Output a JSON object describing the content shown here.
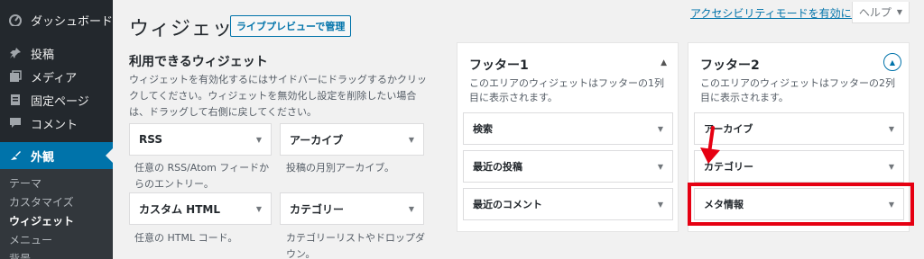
{
  "sidebar": {
    "items": [
      {
        "label": "ダッシュボード",
        "icon": "dashboard-icon"
      },
      {
        "label": "投稿",
        "icon": "pin-icon"
      },
      {
        "label": "メディア",
        "icon": "media-icon"
      },
      {
        "label": "固定ページ",
        "icon": "page-icon"
      },
      {
        "label": "コメント",
        "icon": "comment-icon"
      },
      {
        "label": "外観",
        "icon": "appearance-icon"
      }
    ],
    "submenu": [
      "テーマ",
      "カスタマイズ",
      "ウィジェット",
      "メニュー",
      "背景"
    ]
  },
  "header": {
    "title": "ウィジェット",
    "live_preview": "ライブプレビューで管理",
    "a11y_link": "アクセシビリティモードを有効にする",
    "help": "ヘルプ"
  },
  "available": {
    "title": "利用できるウィジェット",
    "desc": "ウィジェットを有効化するにはサイドバーにドラッグするかクリックしてください。ウィジェットを無効化し設定を削除したい場合は、ドラッグして右側に戻してください。",
    "widgets": [
      {
        "name": "RSS",
        "desc": "任意の RSS/Atom フィードからのエントリー。"
      },
      {
        "name": "アーカイブ",
        "desc": "投稿の月別アーカイブ。"
      },
      {
        "name": "カスタム HTML",
        "desc": "任意の HTML コード。"
      },
      {
        "name": "カテゴリー",
        "desc": "カテゴリーリストやドロップダウン。"
      }
    ]
  },
  "footer1": {
    "title": "フッター1",
    "desc": "このエリアのウィジェットはフッターの1列目に表示されます。",
    "widgets": [
      "検索",
      "最近の投稿",
      "最近のコメント"
    ]
  },
  "footer2": {
    "title": "フッター2",
    "desc": "このエリアのウィジェットはフッターの2列目に表示されます。",
    "widgets": [
      "アーカイブ",
      "カテゴリー",
      "メタ情報"
    ]
  },
  "colors": {
    "accent": "#0073aa",
    "sidebar_bg": "#23282d",
    "highlight": "#e60012"
  }
}
